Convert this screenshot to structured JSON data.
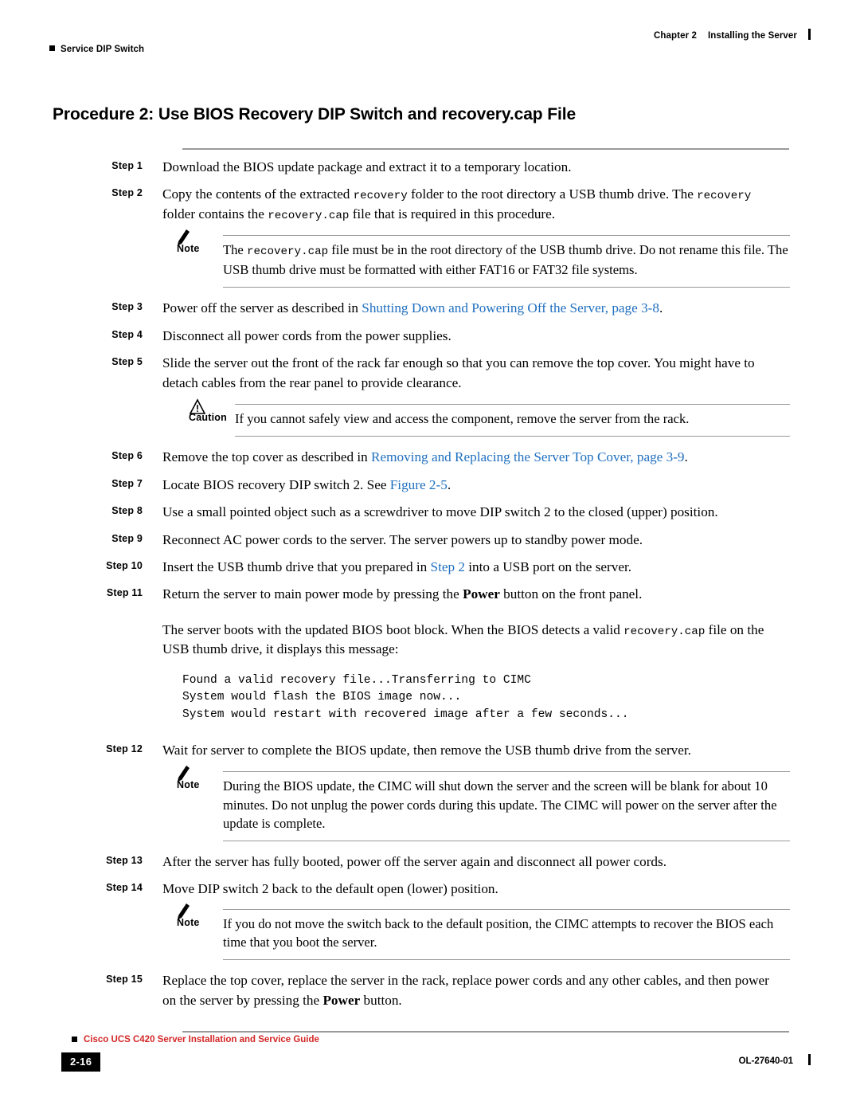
{
  "header": {
    "left_marker": "square-bullet",
    "left_text": "Service DIP Switch",
    "chapter": "Chapter 2",
    "chapter_title": "Installing the Server"
  },
  "title": "Procedure 2: Use BIOS Recovery DIP Switch and recovery.cap File",
  "steps": [
    {
      "label": "Step 1",
      "text": "Download the BIOS update package and extract it to a temporary location."
    },
    {
      "label": "Step 2",
      "text_part1": "Copy the contents of the extracted ",
      "code1": "recovery",
      "text_part2": " folder to the root directory a USB thumb drive. The ",
      "code2": "recovery",
      "text_part3": " folder contains the ",
      "code3": "recovery.cap",
      "text_part4": " file that is required in this procedure."
    },
    {
      "label": "Step 3",
      "text_part1": "Power off the server as described in ",
      "link": "Shutting Down and Powering Off the Server, page 3-8",
      "text_part2": "."
    },
    {
      "label": "Step 4",
      "text": "Disconnect all power cords from the power supplies."
    },
    {
      "label": "Step 5",
      "text": "Slide the server out the front of the rack far enough so that you can remove the top cover. You might have to detach cables from the rear panel to provide clearance."
    },
    {
      "label": "Step 6",
      "text_part1": "Remove the top cover as described in ",
      "link": "Removing and Replacing the Server Top Cover, page 3-9",
      "text_part2": "."
    },
    {
      "label": "Step 7",
      "text_part1": "Locate BIOS recovery DIP switch 2. See ",
      "link": "Figure 2-5",
      "text_part2": "."
    },
    {
      "label": "Step 8",
      "text": "Use a small pointed object such as a screwdriver to move DIP switch 2 to the closed (upper) position."
    },
    {
      "label": "Step 9",
      "text": "Reconnect AC power cords to the server. The server powers up to standby power mode."
    },
    {
      "label": "Step 10",
      "text_part1": "Insert the USB thumb drive that you prepared in ",
      "link": "Step 2",
      "text_part2": " into a USB port on the server."
    },
    {
      "label": "Step 11",
      "text_part1": "Return the server to main power mode by pressing the ",
      "bold": "Power",
      "text_part2": " button on the front panel."
    },
    {
      "label": "Step 12",
      "text": "Wait for server to complete the BIOS update, then remove the USB thumb drive from the server."
    },
    {
      "label": "Step 13",
      "text": "After the server has fully booted, power off the server again and disconnect all power cords."
    },
    {
      "label": "Step 14",
      "text": "Move DIP switch 2 back to the default open (lower) position."
    },
    {
      "label": "Step 15",
      "text_part1": "Replace the top cover, replace the server in the rack, replace power cords and any other cables, and then power on the server by pressing the ",
      "bold": "Power",
      "text_part2": " button."
    }
  ],
  "step11_continuation": {
    "text_part1": "The server boots with the updated BIOS boot block. When the BIOS detects a valid ",
    "code": "recovery.cap",
    "text_part2": " file on the USB thumb drive, it displays this message:"
  },
  "code_block": "Found a valid recovery file...Transferring to CIMC\nSystem would flash the BIOS image now...\nSystem would restart with recovered image after a few seconds...",
  "notes": [
    {
      "label": "Note",
      "icon": "note-pencil-icon",
      "text_part1": "The ",
      "code": "recovery.cap",
      "text_part2": " file must be in the root directory of the USB thumb drive. Do not rename this file. The USB thumb drive must be formatted with either FAT16 or FAT32 file systems."
    },
    {
      "label": "Caution",
      "icon": "caution-triangle-icon",
      "text": "If you cannot safely view and access the component, remove the server from the rack."
    },
    {
      "label": "Note",
      "icon": "note-pencil-icon",
      "text": "During the BIOS update, the CIMC will shut down the server and the screen will be blank for about 10 minutes. Do not unplug the power cords during this update. The CIMC will power on the server after the update is complete."
    },
    {
      "label": "Note",
      "icon": "note-pencil-icon",
      "text": "If you do not move the switch back to the default position, the CIMC attempts to recover the BIOS each time that you boot the server."
    }
  ],
  "footer": {
    "guide_title": "Cisco UCS C420 Server Installation and Service Guide",
    "page_number": "2-16",
    "doc_id": "OL-27640-01"
  },
  "colors": {
    "link": "#1f6fbf",
    "footer_red": "#d32626",
    "rule_gray": "#9a9a9a"
  }
}
